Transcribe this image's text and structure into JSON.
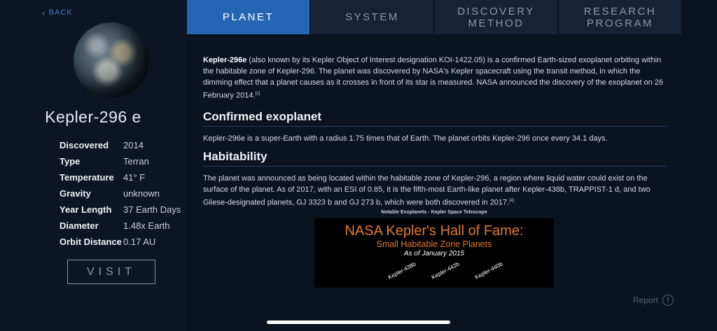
{
  "nav": {
    "back_label": "BACK"
  },
  "planet": {
    "name": "Kepler-296 e",
    "stats": [
      {
        "label": "Discovered",
        "value": "2014"
      },
      {
        "label": "Type",
        "value": "Terran"
      },
      {
        "label": "Temperature",
        "value": "41° F"
      },
      {
        "label": "Gravity",
        "value": "unknown"
      },
      {
        "label": "Year Length",
        "value": "37 Earth Days"
      },
      {
        "label": "Diameter",
        "value": "1.48x Earth"
      },
      {
        "label": "Orbit Distance",
        "value": "0.17 AU"
      }
    ],
    "visit_label": "VISIT"
  },
  "tabs": [
    {
      "line1": "PLANET",
      "line2": "",
      "active": true
    },
    {
      "line1": "SYSTEM",
      "line2": "",
      "active": false
    },
    {
      "line1": "DISCOVERY",
      "line2": "METHOD",
      "active": false
    },
    {
      "line1": "RESEARCH",
      "line2": "PROGRAM",
      "active": false
    }
  ],
  "article": {
    "intro_bold": "Kepler-296e",
    "intro_text": " (also known by its Kepler Object of Interest designation KOI-1422.05) is a confirmed Earth-sized exoplanet orbiting within the habitable zone of Kepler-296. The planet was discovered by NASA's Kepler spacecraft using the transit method, in which the dimming effect that a planet causes as it crosses in front of its star is measured. NASA announced the discovery of the exoplanet on 26 February 2014.",
    "intro_ref": "[1]",
    "section1_heading": "Confirmed exoplanet",
    "section1_text": "Kepler-296e is a super-Earth with a radius 1.75 times that of Earth. The planet orbits Kepler-296 once every 34.1 days.",
    "section2_heading": "Habitability",
    "section2_text": "The planet was announced as being located within the habitable zone of Kepler-296, a region where liquid water could exist on the surface of the planet. As of 2017, with an ESI of 0.85, it is the fifth-most Earth-like planet after Kepler-438b, TRAPPIST-1 d, and two Gliese-designated planets, GJ 3323 b and GJ 273 b, which were both discovered in 2017.",
    "section2_ref": "[4]"
  },
  "figure": {
    "caption": "Notable Exoplanets - Kepler Space Telescope",
    "title": "NASA Kepler's Hall of Fame:",
    "subtitle": "Small Habitable Zone Planets",
    "date": "As of January 2015",
    "labels": [
      "Kepler-438b",
      "Kepler-442b",
      "Kepler-440b"
    ],
    "accent_color": "#e07a2e"
  },
  "footer": {
    "report_label": "Report",
    "report_icon": "!"
  },
  "colors": {
    "accent": "#2566b4",
    "background": "#0b1220",
    "link": "#3d7fcc"
  }
}
